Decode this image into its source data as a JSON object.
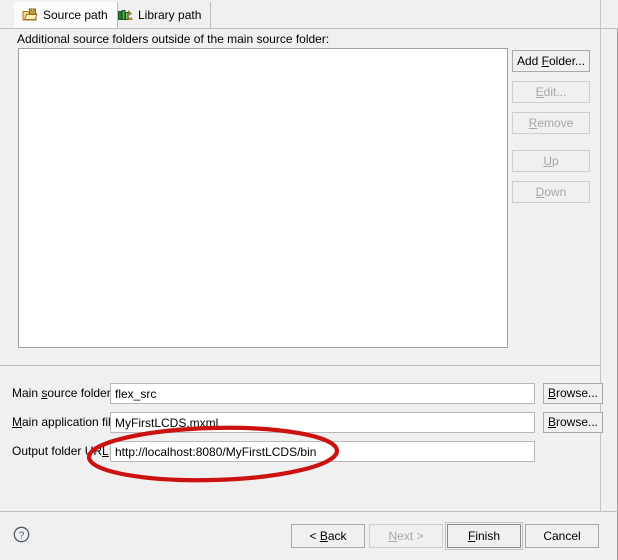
{
  "dialog": {
    "instruction": "Additional source folders outside of the main source folder:"
  },
  "tabs": [
    {
      "label": "Source path",
      "icon": "folder-package-icon",
      "selected": true
    },
    {
      "label": "Library path",
      "icon": "books-icon",
      "selected": false
    }
  ],
  "folder_list": {
    "items": [],
    "empty": true
  },
  "side_buttons": [
    {
      "label": "Add Folder...",
      "mnemonic": "F",
      "enabled": true
    },
    {
      "label": "Edit...",
      "mnemonic": "E",
      "enabled": false
    },
    {
      "label": "Remove",
      "mnemonic": "R",
      "enabled": false
    },
    {
      "label": "Up",
      "mnemonic": "U",
      "enabled": false
    },
    {
      "label": "Down",
      "mnemonic": "D",
      "enabled": false
    }
  ],
  "form": {
    "main_source_folder": {
      "label_before": "Main ",
      "label_mnemonic": "s",
      "label_after": "ource folder:",
      "value": "flex_src"
    },
    "main_application_file": {
      "label_before": "",
      "label_mnemonic": "M",
      "label_after": "ain application file:",
      "value": "MyFirstLCDS.mxml"
    },
    "output_folder_url": {
      "label_before": "Output folder UR",
      "label_mnemonic": "L",
      "label_after": ":",
      "value": "http://localhost:8080/MyFirstLCDS/bin"
    },
    "browse_label_before": "",
    "browse_mnemonic": "B",
    "browse_label_after": "rowse..."
  },
  "nav_buttons": {
    "back": {
      "label": "< Back",
      "mnemonic": "B",
      "enabled": true,
      "default": false
    },
    "next": {
      "label": "Next >",
      "mnemonic": "N",
      "enabled": false,
      "default": false
    },
    "finish": {
      "label": "Finish",
      "mnemonic": "F",
      "enabled": true,
      "default": true
    },
    "cancel": {
      "label": "Cancel",
      "mnemonic": "",
      "enabled": true,
      "default": false
    }
  },
  "help": {
    "icon": "help-circle-icon",
    "glyph": "?"
  },
  "annotation": {
    "shape": "ellipse",
    "color": "#cc1111",
    "target": "output_folder_url"
  },
  "colors": {
    "dialog_background": "#f0f0f0",
    "field_background": "#ffffff",
    "border": "#a9a9a9",
    "disabled_text": "#a8a8a8",
    "annotation_red": "#cc1111",
    "tab_selected_background": "#fbfbfb"
  }
}
